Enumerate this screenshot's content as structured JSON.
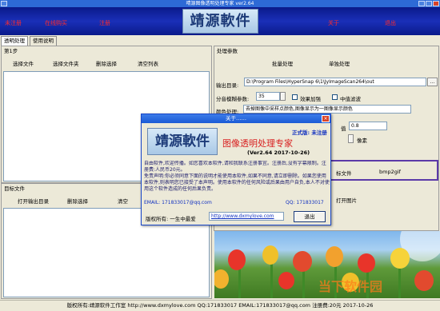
{
  "window": {
    "title": "晴源图像透明处理专家 ver2.64"
  },
  "banner": {
    "links_left": [
      "未注册",
      "在线购买",
      "注册"
    ],
    "links_right": [
      "关于",
      "退出"
    ],
    "logo_text": "靖源軟件"
  },
  "tabs": [
    "透明处理",
    "使用说明"
  ],
  "step1": {
    "legend": "第1步",
    "buttons": [
      "选择文件",
      "选择文件夹",
      "删除选择",
      "清空列表"
    ]
  },
  "target": {
    "legend": "目标文件",
    "buttons": [
      "打开输出目录",
      "删除选择",
      "清空"
    ]
  },
  "params": {
    "legend": "处理参数",
    "mode_batch": "批量处理",
    "mode_single": "单独处理",
    "output_label": "输出目录:",
    "output_value": "D:\\Program Files\\HyperSnap 6\\1\\JyImageScan264\\out",
    "browse_label": "...",
    "blur_label": "分音模糊参数:",
    "blur_value": "35",
    "effect_enhance": "效果加强",
    "median_filter": "中值滤波",
    "color_label": "颜色处理:",
    "color_value": "去掉图像中采样点颜色,图像显示为一图像显示颜色",
    "value_label": "值",
    "value_value": "0.8",
    "pixel_label": "像素",
    "file_label": "标文件",
    "format_label": "bmp2gif",
    "open_image": "打开图片"
  },
  "dialog": {
    "title": "关于……",
    "close": "×",
    "logo_text": "靖源軟件",
    "edition": "正式版: 未注册",
    "product": "图像透明处理专家",
    "version": "(Ver2.64  2017-10-26)",
    "description": "自由软件,欢迎传播。如您喜欢本软件,请和我联系注册事宜。注册后,没有字幕限制。注册费:人民币20元。\n免责声明:你必须同意下面的说明才能使用本软件,如果不同意,请立即删除。如果您使用本软件,则表明您已接受了本声明。使用本软件的任何风险或后果由用户自负,本人不对使用这个软件造成的任何后果负责。",
    "email": "EMAIL: 171833017@qq.com",
    "qq": "QQ: 171833017",
    "copyright_label": "版权所有: 一生中最爱",
    "website": "http://www.dxmylove.com",
    "exit_button": "退出"
  },
  "statusbar": {
    "text": "版权所有:靖源软件工作室 http://www.dxmylove.com QQ:171833017 EMAIL:171833017@qq.com 注册费:20元 2017-10-26"
  },
  "watermark": {
    "text": "当下软件园"
  },
  "colors": {
    "banner": "#1a2fb8",
    "accent": "#ff2b2b",
    "titlebar": "#2d6ad6"
  }
}
